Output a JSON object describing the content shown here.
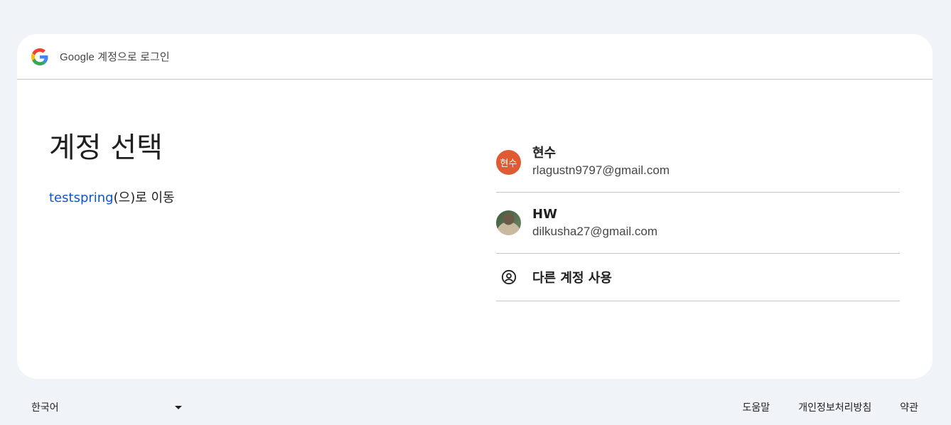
{
  "header": {
    "title": "Google 계정으로 로그인"
  },
  "main": {
    "title": "계정 선택",
    "continue_app": "testspring",
    "continue_suffix": "(으)로 이동"
  },
  "accounts": [
    {
      "avatar": "현수",
      "name": "현수",
      "email": "rlagustn9797@gmail.com",
      "avatar_color": "#e05a33"
    },
    {
      "avatar": "photo",
      "name": "HW",
      "email": "dilkusha27@gmail.com"
    }
  ],
  "other_account": {
    "icon": "account-circle-icon",
    "label": "다른 계정 사용"
  },
  "footer": {
    "language": "한국어",
    "links": [
      "도움말",
      "개인정보처리방침",
      "약관"
    ]
  },
  "colors": {
    "background": "#f0f4f9",
    "link": "#0b57d0",
    "divider": "#c4c7c5"
  }
}
